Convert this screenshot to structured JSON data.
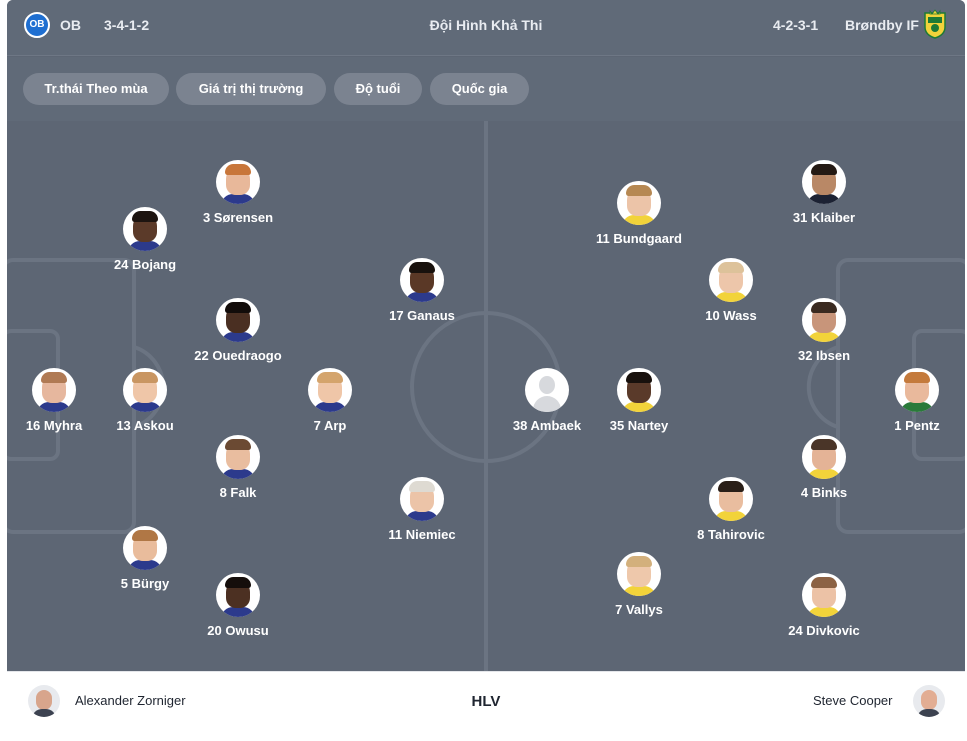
{
  "header": {
    "home_logo_text": "OB",
    "home_team": "OB",
    "home_formation": "3-4-1-2",
    "title": "Đội Hình Khả Thi",
    "away_formation": "4-2-3-1",
    "away_team": "Brøndby IF",
    "away_logo_icon": "brondby-crest-icon"
  },
  "filters": [
    "Tr.thái Theo mùa",
    "Giá trị thị trường",
    "Độ tuổi",
    "Quốc gia"
  ],
  "home_players": [
    {
      "label": "3 Sørensen",
      "skin": "#e8b89a",
      "hair": "#c8763a",
      "shirt": "#2c3a8c"
    },
    {
      "label": "24 Bojang",
      "skin": "#5b3a29",
      "hair": "#1d1410",
      "shirt": "#2c3a8c"
    },
    {
      "label": "22 Ouedraogo",
      "skin": "#4a2f22",
      "hair": "#120c0a",
      "shirt": "#2c3a8c"
    },
    {
      "label": "16 Myhra",
      "skin": "#e6b79e",
      "hair": "#b07a54",
      "shirt": "#2c3a8c"
    },
    {
      "label": "13 Askou",
      "skin": "#efc6a8",
      "hair": "#c99662",
      "shirt": "#2c3a8c"
    },
    {
      "label": "7 Arp",
      "skin": "#efc6a8",
      "hair": "#d4a46c",
      "shirt": "#2c3a8c"
    },
    {
      "label": "8 Falk",
      "skin": "#e9bd9f",
      "hair": "#6b4a33",
      "shirt": "#2c3a8c"
    },
    {
      "label": "17 Ganaus",
      "skin": "#5a3826",
      "hair": "#18110d",
      "shirt": "#2c3a8c"
    },
    {
      "label": "11 Niemiec",
      "skin": "#ecc4a8",
      "hair": "#dedad2",
      "shirt": "#2c3a8c"
    },
    {
      "label": "5 Bürgy",
      "skin": "#e9bc9c",
      "hair": "#b07745",
      "shirt": "#2c3a8c"
    },
    {
      "label": "20 Owusu",
      "skin": "#4c3022",
      "hair": "#150e0b",
      "shirt": "#2c3a8c"
    }
  ],
  "away_players": [
    {
      "label": "31 Klaiber",
      "skin": "#b98866",
      "hair": "#241a14",
      "shirt": "#1c2233"
    },
    {
      "label": "11 Bundgaard",
      "skin": "#ecc4a8",
      "hair": "#b68852",
      "shirt": "#f2d33a"
    },
    {
      "label": "10 Wass",
      "skin": "#edc6aa",
      "hair": "#ddc29a",
      "shirt": "#f2d33a"
    },
    {
      "label": "32 Ibsen",
      "skin": "#c8957a",
      "hair": "#3a2a20",
      "shirt": "#f2d33a"
    },
    {
      "label": "38 Ambaek",
      "skin": "",
      "hair": "",
      "shirt": ""
    },
    {
      "label": "35 Nartey",
      "skin": "#5a3a2a",
      "hair": "#18110d",
      "shirt": "#f2d33a"
    },
    {
      "label": "1 Pentz",
      "skin": "#e9b99c",
      "hair": "#c47a3c",
      "shirt": "#2a7a3a"
    },
    {
      "label": "4 Binks",
      "skin": "#e4b396",
      "hair": "#4a3528",
      "shirt": "#f2d33a"
    },
    {
      "label": "8 Tahirovic",
      "skin": "#e9bd9f",
      "hair": "#2a1f18",
      "shirt": "#f2d33a"
    },
    {
      "label": "7 Vallys",
      "skin": "#eec8ab",
      "hair": "#d3b07c",
      "shirt": "#f2d33a"
    },
    {
      "label": "24 Divkovic",
      "skin": "#ecc2a6",
      "hair": "#8c6244",
      "shirt": "#f2d33a"
    }
  ],
  "coaches": {
    "home_name": "Alexander Zorniger",
    "center_label": "HLV",
    "away_name": "Steve Cooper"
  }
}
